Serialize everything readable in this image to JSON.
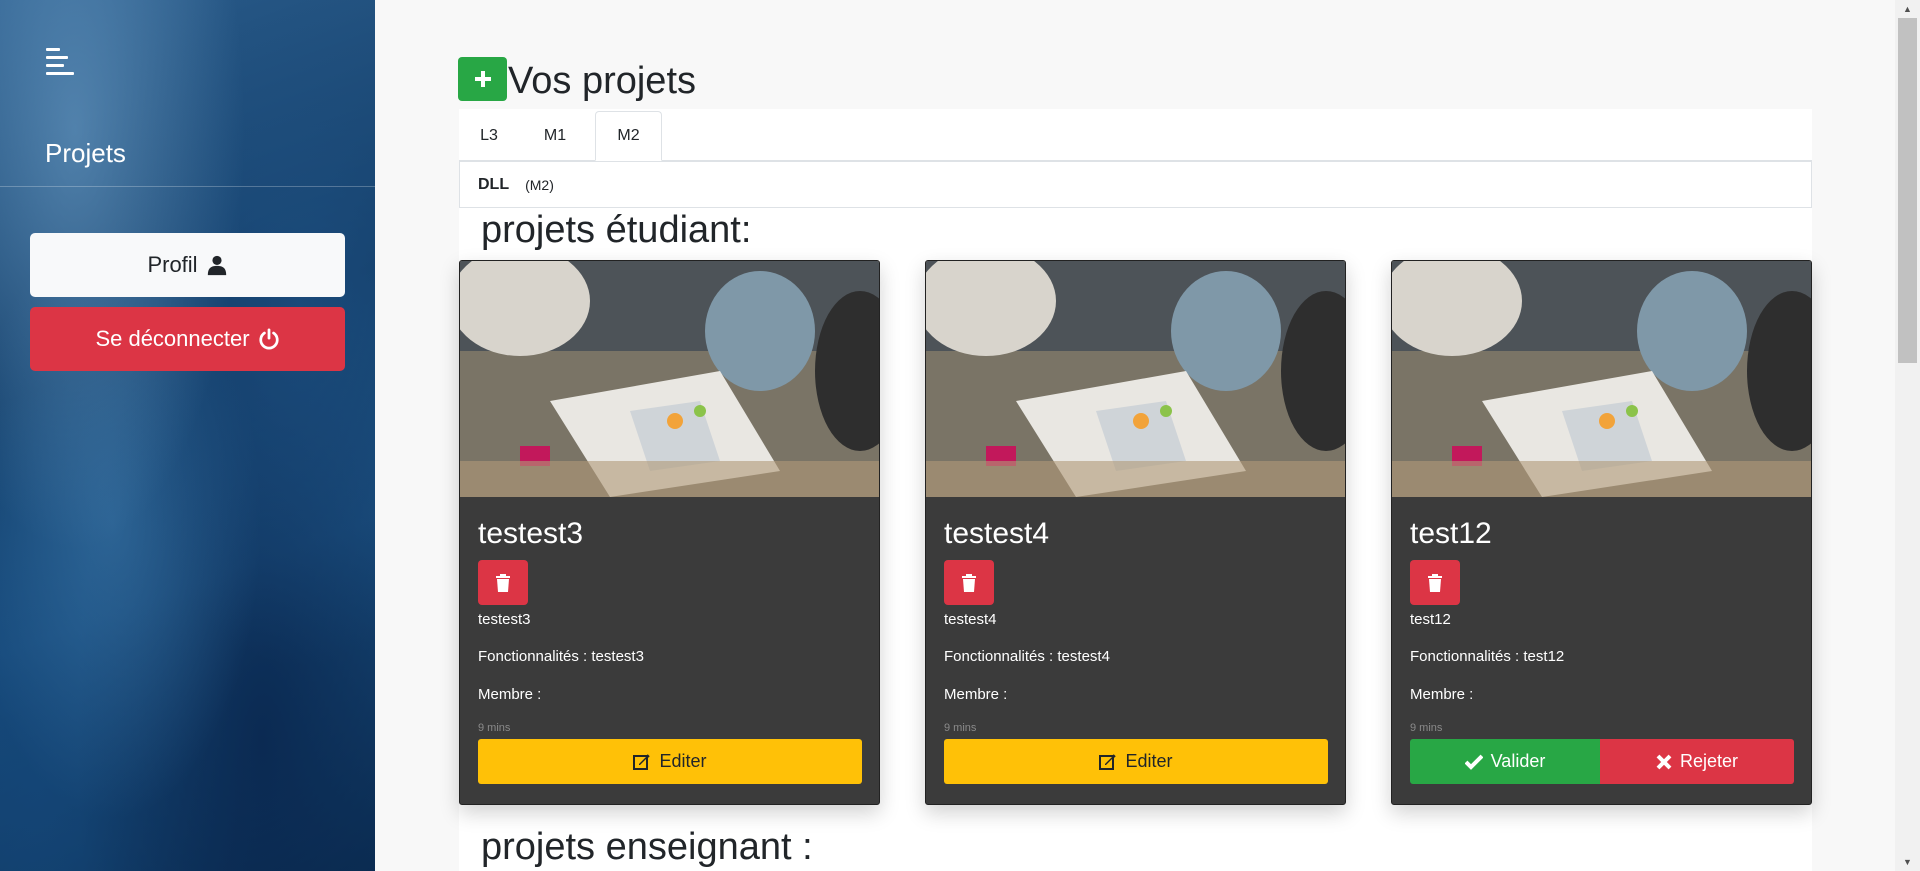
{
  "sidebar": {
    "title": "Projets",
    "profil_label": "Profil",
    "logout_label": "Se déconnecter"
  },
  "header": {
    "title": "Vos projets"
  },
  "tabs": [
    {
      "label": "L3",
      "active": false
    },
    {
      "label": "M1",
      "active": false
    },
    {
      "label": "M2",
      "active": true
    }
  ],
  "subbar": {
    "course": "DLL",
    "level": "(M2)"
  },
  "sections": {
    "student": "projets étudiant:",
    "teacher": "projets enseignant :"
  },
  "cards": [
    {
      "title": "testest3",
      "description": "testest3",
      "features": "Fonctionnalités : testest3",
      "members": "Membre :",
      "time": "9 mins",
      "edit_label": "Editer"
    },
    {
      "title": "testest4",
      "description": "testest4",
      "features": "Fonctionnalités : testest4",
      "members": "Membre :",
      "time": "9 mins",
      "edit_label": "Editer"
    },
    {
      "title": "test12",
      "description": "test12",
      "features": "Fonctionnalités : test12",
      "members": "Membre :",
      "time": "9 mins",
      "validate_label": "Valider",
      "reject_label": "Rejeter"
    }
  ],
  "colors": {
    "success": "#28a745",
    "danger": "#dc3545",
    "warning": "#ffc107",
    "card_bg": "#3b3b3b"
  },
  "icons": {
    "menu": "hamburger-menu-icon",
    "profile": "user-icon",
    "logout": "power-icon",
    "add": "plus-icon",
    "delete": "trash-icon",
    "edit": "edit-icon",
    "validate": "check-icon",
    "reject": "times-icon"
  }
}
